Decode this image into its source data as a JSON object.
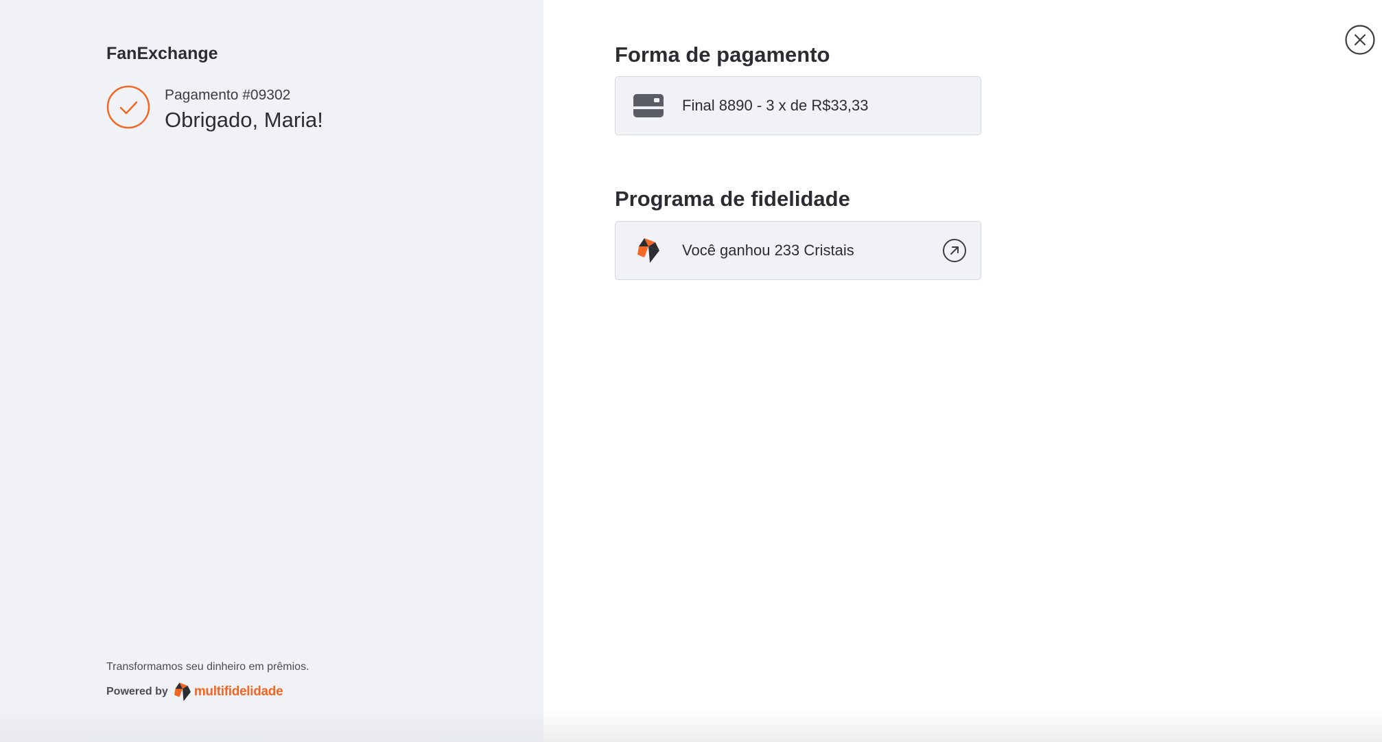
{
  "brand": {
    "name": "FanExchange"
  },
  "confirmation": {
    "payment_id": "Pagamento #09302",
    "message": "Obrigado, Maria!"
  },
  "footer": {
    "tagline": "Transformamos seu dinheiro em prêmios.",
    "powered_by": "Powered by",
    "logo_text": "multifidelidade"
  },
  "payment_section": {
    "title": "Forma de pagamento",
    "card_text": "Final 8890 - 3 x de R$33,33",
    "icon": "credit-card-icon"
  },
  "loyalty_section": {
    "title": "Programa de fidelidade",
    "card_text": "Você ganhou 233 Cristais",
    "icon": "crystal-logo-icon",
    "action_icon": "arrow-up-right-icon"
  },
  "colors": {
    "accent": "#f26522",
    "dark": "#2b2d33",
    "panel_bg": "#f1f2f5"
  }
}
